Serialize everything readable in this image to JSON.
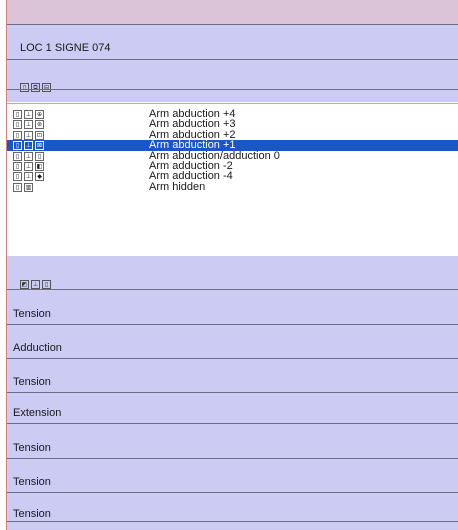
{
  "header": {
    "title": "LOC 1 SIGNE 074"
  },
  "toolbar_top": {
    "icons": [
      "▯",
      "⧉",
      "⊟"
    ]
  },
  "list": {
    "items": [
      {
        "icons": [
          "▯",
          "⊥",
          "⊕"
        ],
        "label": "Arm abduction +4",
        "selected": false
      },
      {
        "icons": [
          "▯",
          "⊥",
          "⊛"
        ],
        "label": "Arm abduction +3",
        "selected": false
      },
      {
        "icons": [
          "▯",
          "⊥",
          "⊡"
        ],
        "label": "Arm abduction +2",
        "selected": false
      },
      {
        "icons": [
          "▯",
          "⊥",
          "⊠"
        ],
        "label": "Arm abduction +1",
        "selected": true
      },
      {
        "icons": [
          "▯",
          "⊥",
          "▯"
        ],
        "label": "Arm abduction/adduction 0",
        "selected": false
      },
      {
        "icons": [
          "▯",
          "⊥",
          "◧"
        ],
        "label": "Arm adduction -2",
        "selected": false
      },
      {
        "icons": [
          "▯",
          "⊥",
          "◆"
        ],
        "label": "Arm adduction -4",
        "selected": false
      },
      {
        "icons": [
          "▯",
          "▥"
        ],
        "label": "Arm hidden",
        "selected": false
      }
    ]
  },
  "toolbar_mid": {
    "icons": [
      "◩",
      "⊥",
      "▯"
    ]
  },
  "rows": [
    "Tension",
    "Adduction",
    "Tension",
    "Extension",
    "Tension",
    "Tension",
    "Tension"
  ],
  "colors": {
    "band": "#cbcbf4",
    "selection": "#1a56c8",
    "top_strip": "#dcc4d8"
  }
}
